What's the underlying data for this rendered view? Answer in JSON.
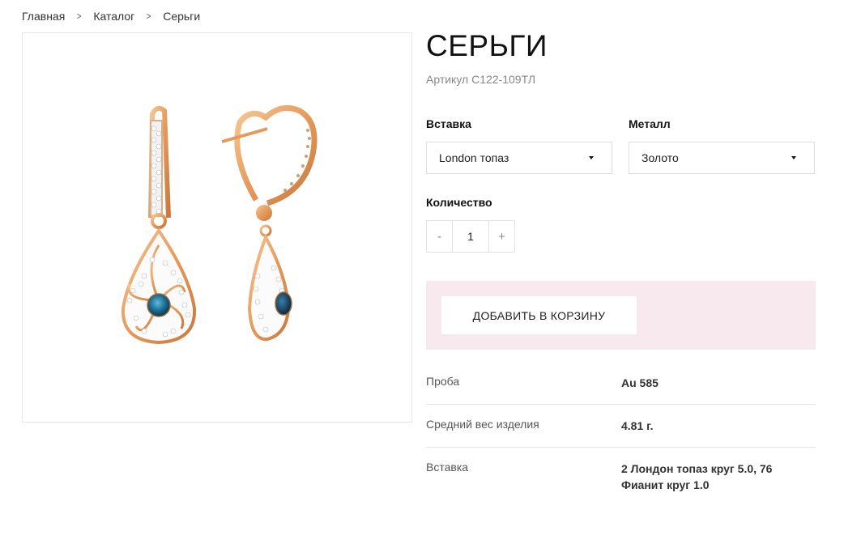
{
  "breadcrumb": {
    "items": [
      "Главная",
      "Каталог",
      "Серьги"
    ]
  },
  "product": {
    "title": "СЕРЬГИ",
    "sku": "Артикул С122-109ТЛ"
  },
  "options": {
    "insert_label": "Вставка",
    "insert_value": "London топаз",
    "metal_label": "Металл",
    "metal_value": "Золото"
  },
  "quantity": {
    "label": "Количество",
    "minus": "-",
    "value": "1",
    "plus": "+"
  },
  "cart": {
    "button_label": "ДОБАВИТЬ В КОРЗИНУ"
  },
  "specs": [
    {
      "key": "Проба",
      "value": "Au 585"
    },
    {
      "key": "Средний вес изделия",
      "value": "4.81 г."
    },
    {
      "key": "Вставка",
      "value": "2 Лондон топаз круг 5.0, 76 Фианит круг 1.0"
    }
  ],
  "colors": {
    "gold": "#e9a869",
    "topaz": "#1f6f95",
    "cart_panel": "#f8e9ef"
  },
  "icons": {
    "breadcrumb_separator": "chevron-right-icon",
    "select_caret": "caret-down-icon"
  }
}
